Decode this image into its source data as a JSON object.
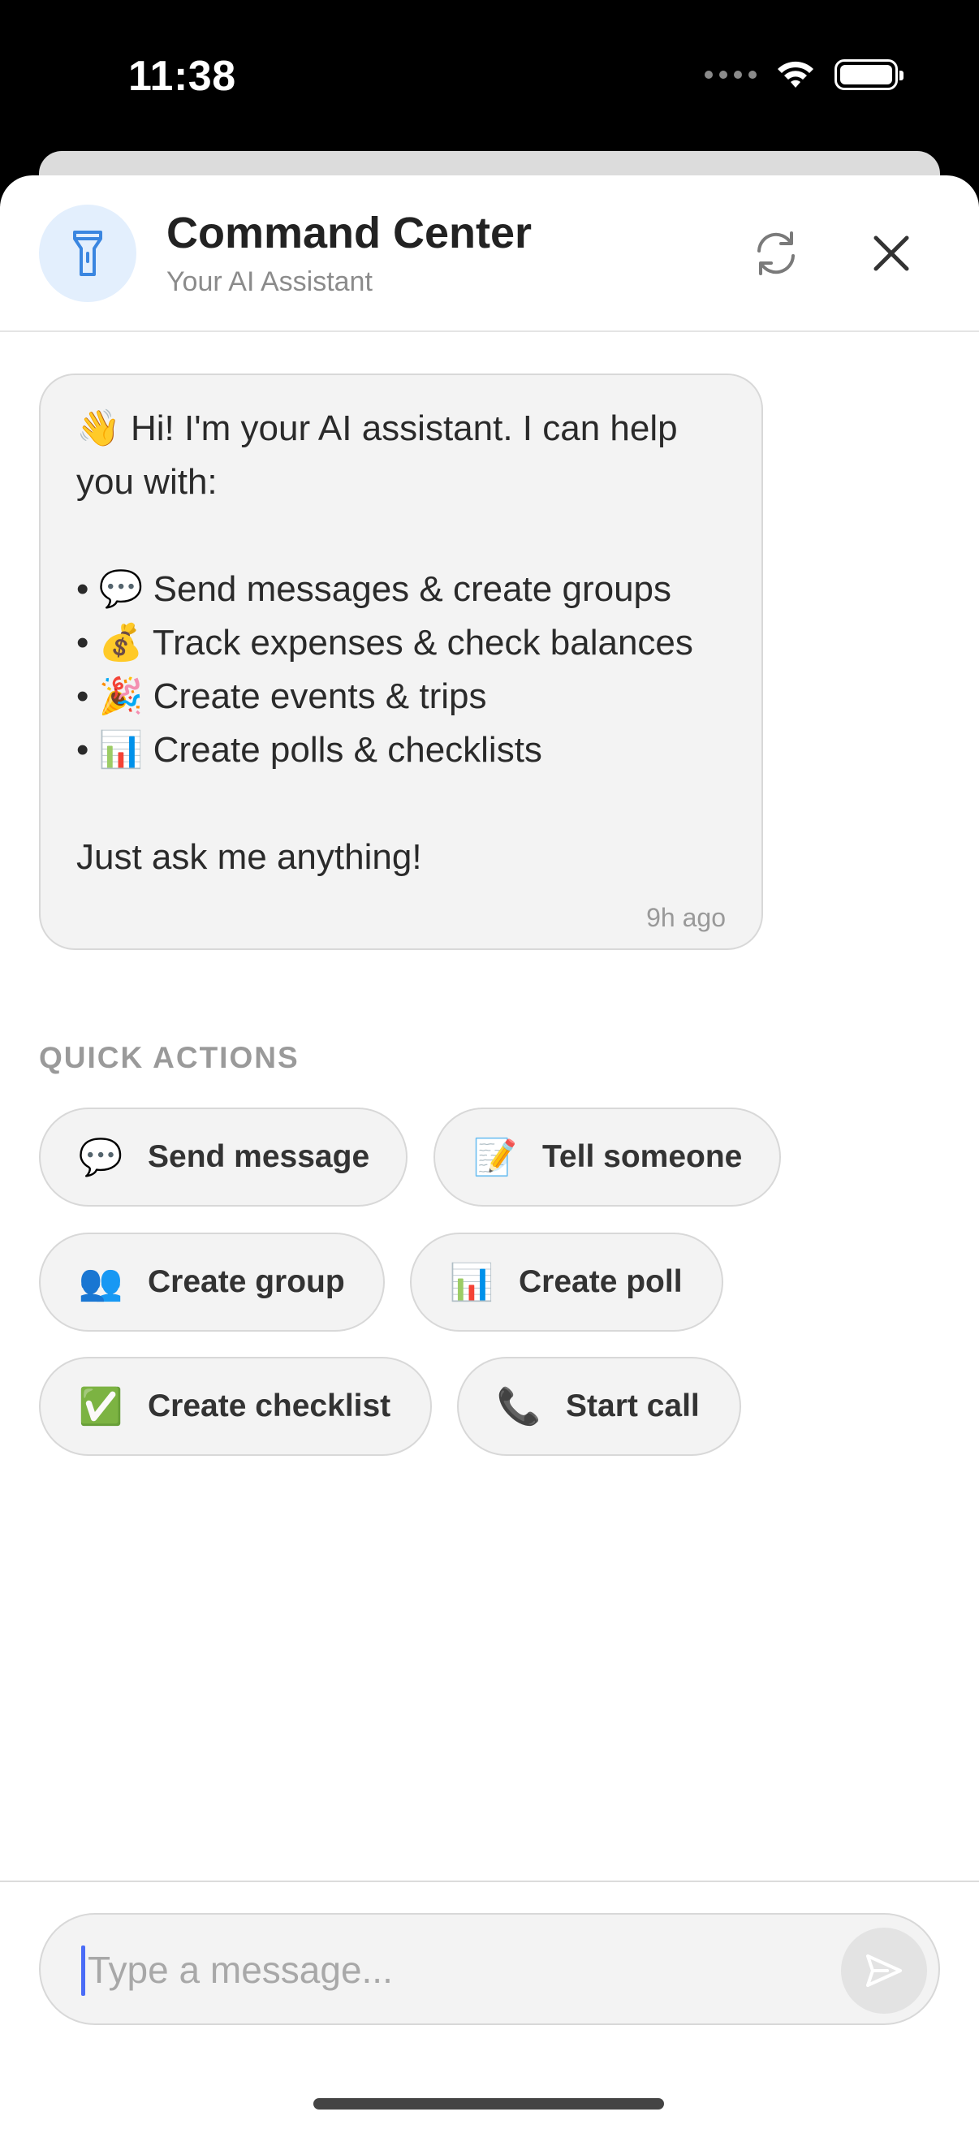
{
  "status_bar": {
    "time": "11:38"
  },
  "header": {
    "title": "Command Center",
    "subtitle": "Your AI Assistant",
    "avatar_icon": "flashlight-icon",
    "refresh_icon": "refresh-icon",
    "close_icon": "close-icon"
  },
  "message": {
    "lines": [
      "👋 Hi! I'm your AI assistant. I can help",
      "you with:",
      "",
      "• 💬 Send messages & create groups",
      "• 💰 Track expenses & check balances",
      "• 🎉 Create events & trips",
      "• 📊 Create polls & checklists",
      "",
      "Just ask me anything!"
    ],
    "timestamp": "9h ago"
  },
  "quick_actions": {
    "label": "QUICK ACTIONS",
    "items": [
      {
        "emoji": "💬",
        "label": "Send message"
      },
      {
        "emoji": "📝",
        "label": "Tell someone"
      },
      {
        "emoji": "👥",
        "label": "Create group"
      },
      {
        "emoji": "📊",
        "label": "Create poll"
      },
      {
        "emoji": "✅",
        "label": "Create checklist"
      },
      {
        "emoji": "📞",
        "label": "Start call"
      }
    ]
  },
  "composer": {
    "placeholder": "Type a message...",
    "send_icon": "send-icon"
  },
  "colors": {
    "accent": "#4a6cf7",
    "avatar_bg": "#e3effd",
    "avatar_icon": "#3a86e0",
    "bubble_bg": "#f3f3f3"
  }
}
